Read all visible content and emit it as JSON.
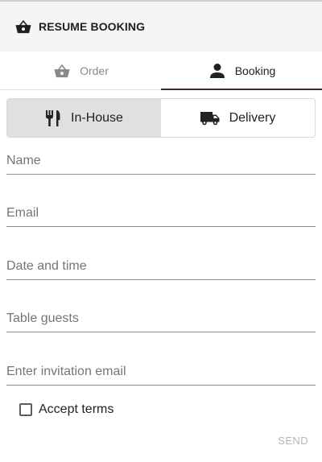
{
  "header": {
    "title": "RESUME BOOKING",
    "icon": "basket-icon"
  },
  "tabs": [
    {
      "label": "Order",
      "icon": "basket-icon",
      "active": false
    },
    {
      "label": "Booking",
      "icon": "person-icon",
      "active": true
    }
  ],
  "mode_toggle": [
    {
      "label": "In-House",
      "icon": "fork-knife-icon",
      "selected": true
    },
    {
      "label": "Delivery",
      "icon": "truck-icon",
      "selected": false
    }
  ],
  "form": {
    "name": {
      "placeholder": "Name",
      "value": ""
    },
    "email": {
      "placeholder": "Email",
      "value": ""
    },
    "datetime": {
      "placeholder": "Date and time",
      "value": ""
    },
    "guests": {
      "placeholder": "Table guests",
      "value": ""
    },
    "invite": {
      "placeholder": "Enter invitation email",
      "value": ""
    },
    "terms_label": "Accept terms",
    "terms_checked": false,
    "send_label": "SEND"
  },
  "colors": {
    "accent": "#3a2a2a",
    "header_bg": "#f5f5f5",
    "selected_bg": "#e0e0e0",
    "disabled": "#b5b5b5"
  }
}
